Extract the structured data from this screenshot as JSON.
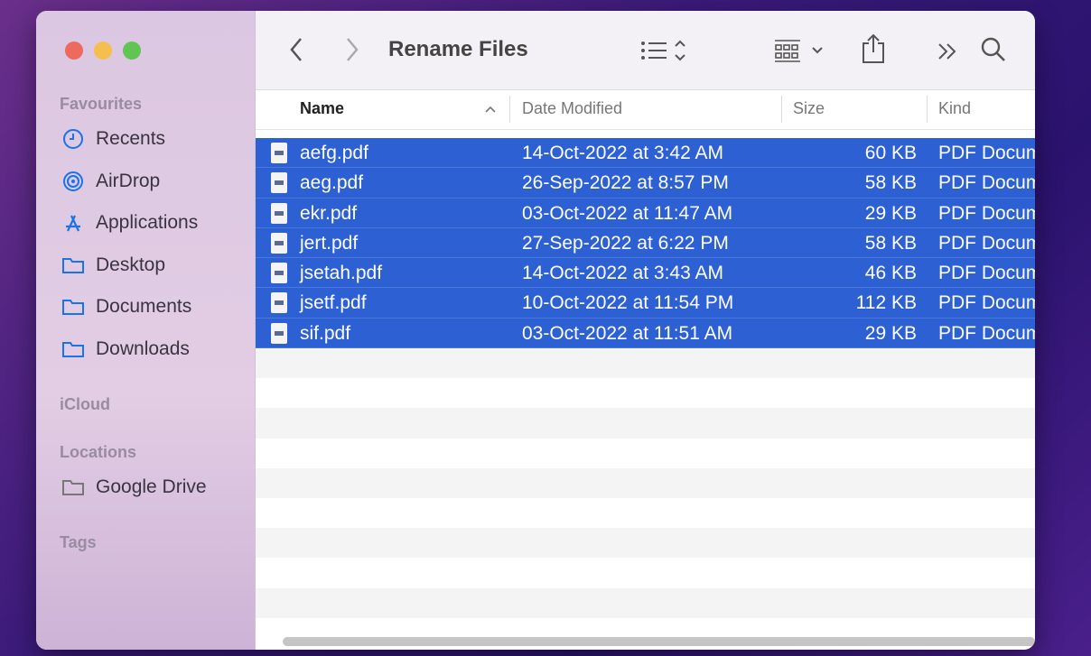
{
  "window": {
    "title": "Rename Files"
  },
  "sidebar": {
    "favourites_label": "Favourites",
    "favourites": [
      {
        "label": "Recents",
        "icon": "clock-icon"
      },
      {
        "label": "AirDrop",
        "icon": "airdrop-icon"
      },
      {
        "label": "Applications",
        "icon": "applications-icon"
      },
      {
        "label": "Desktop",
        "icon": "folder-icon"
      },
      {
        "label": "Documents",
        "icon": "folder-icon"
      },
      {
        "label": "Downloads",
        "icon": "folder-icon"
      }
    ],
    "icloud_label": "iCloud",
    "locations_label": "Locations",
    "locations": [
      {
        "label": "Google Drive",
        "icon": "folder-icon"
      }
    ],
    "tags_label": "Tags"
  },
  "columns": {
    "name": "Name",
    "date": "Date Modified",
    "size": "Size",
    "kind": "Kind"
  },
  "files": [
    {
      "name": "aefg.pdf",
      "date": "14-Oct-2022 at 3:42 AM",
      "size": "60 KB",
      "kind": "PDF Docum"
    },
    {
      "name": "aeg.pdf",
      "date": "26-Sep-2022 at 8:57 PM",
      "size": "58 KB",
      "kind": "PDF Docum"
    },
    {
      "name": "ekr.pdf",
      "date": "03-Oct-2022 at 11:47 AM",
      "size": "29 KB",
      "kind": "PDF Docum"
    },
    {
      "name": "jert.pdf",
      "date": "27-Sep-2022 at 6:22 PM",
      "size": "58 KB",
      "kind": "PDF Docum"
    },
    {
      "name": "jsetah.pdf",
      "date": "14-Oct-2022 at 3:43 AM",
      "size": "46 KB",
      "kind": "PDF Docum"
    },
    {
      "name": "jsetf.pdf",
      "date": "10-Oct-2022 at 11:54 PM",
      "size": "112 KB",
      "kind": "PDF Docum"
    },
    {
      "name": "sif.pdf",
      "date": "03-Oct-2022 at 11:51 AM",
      "size": "29 KB",
      "kind": "PDF Docum"
    }
  ],
  "colors": {
    "selection": "#2c60d3",
    "accent": "#1a73e8"
  }
}
